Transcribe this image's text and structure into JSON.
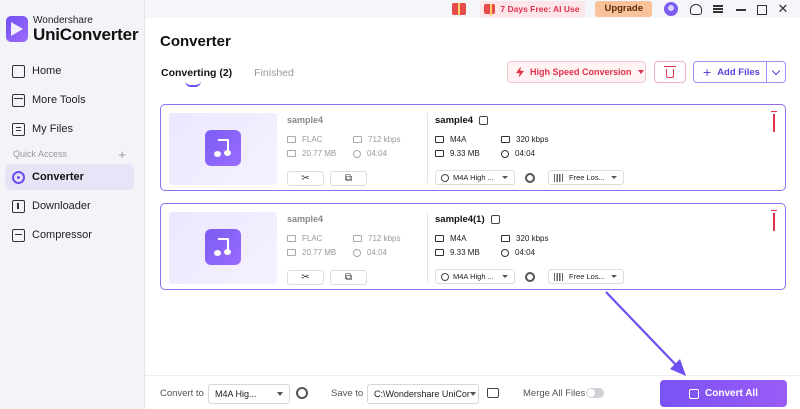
{
  "brand": {
    "top": "Wondershare",
    "name": "UniConverter"
  },
  "topbar": {
    "promo": "7 Days Free: AI Use",
    "upgrade": "Upgrade"
  },
  "sidebar": {
    "items": [
      {
        "label": "Home",
        "icon": "home-icon"
      },
      {
        "label": "More Tools",
        "icon": "tools-icon"
      },
      {
        "label": "My Files",
        "icon": "files-icon"
      }
    ],
    "quick_access": "Quick Access",
    "quick_items": [
      {
        "label": "Converter",
        "icon": "converter-icon",
        "active": true
      },
      {
        "label": "Downloader",
        "icon": "download-icon"
      },
      {
        "label": "Compressor",
        "icon": "compress-icon"
      }
    ]
  },
  "main": {
    "title": "Converter",
    "tabs": [
      {
        "label": "Converting (2)",
        "active": true
      },
      {
        "label": "Finished",
        "active": false
      }
    ],
    "high_speed": "High Speed Conversion",
    "add_files": "Add Files"
  },
  "files": [
    {
      "src_name": "sample4",
      "src_format": "FLAC",
      "src_bitrate": "712 kbps",
      "src_size": "20.77 MB",
      "src_duration": "04:04",
      "dst_name": "sample4",
      "dst_format": "M4A",
      "dst_bitrate": "320 kbps",
      "dst_size": "9.33 MB",
      "dst_duration": "04:04",
      "preset": "M4A High ...",
      "subtitle": "Free Los..."
    },
    {
      "src_name": "sample4",
      "src_format": "FLAC",
      "src_bitrate": "712 kbps",
      "src_size": "20.77 MB",
      "src_duration": "04:04",
      "dst_name": "sample4(1)",
      "dst_format": "M4A",
      "dst_bitrate": "320 kbps",
      "dst_size": "9.33 MB",
      "dst_duration": "04:04",
      "preset": "M4A High ...",
      "subtitle": "Free Los..."
    }
  ],
  "bottom": {
    "convert_to_label": "Convert to",
    "convert_to_value": "M4A Hig...",
    "save_to_label": "Save to",
    "save_to_value": "C:\\Wondershare UniCor",
    "merge_label": "Merge All Files",
    "convert_all": "Convert All"
  },
  "colors": {
    "accent": "#6f4ef2",
    "danger": "#e0314b",
    "upgrade": "#f8c29b"
  }
}
